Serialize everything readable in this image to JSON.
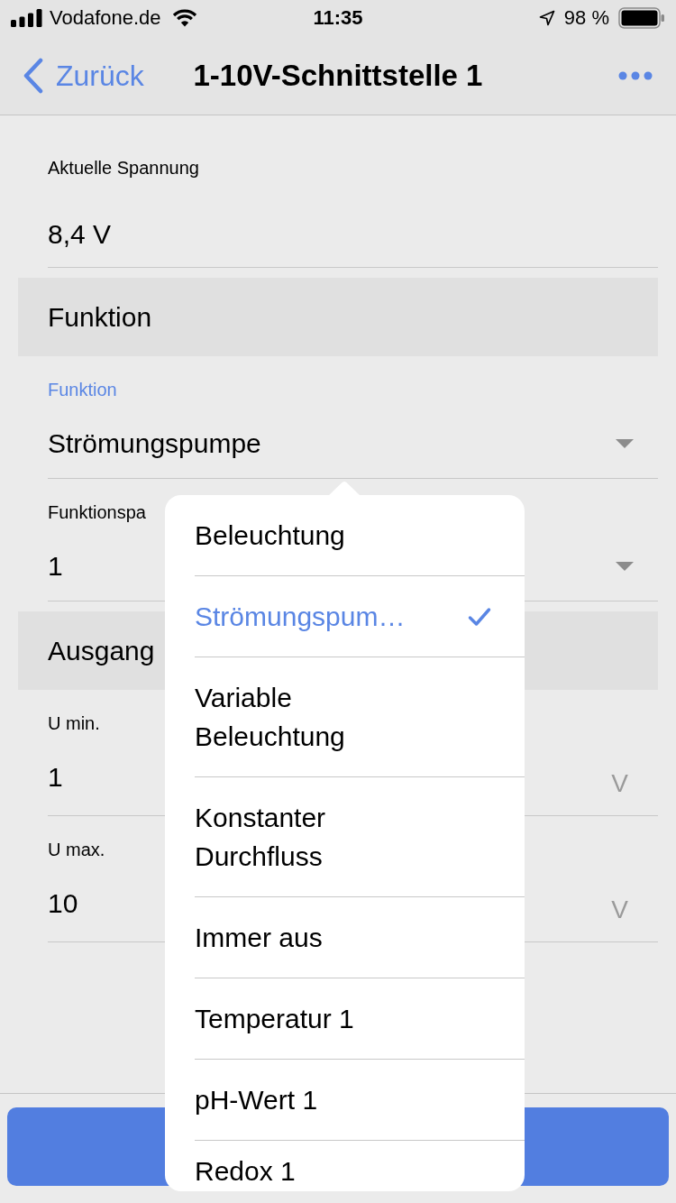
{
  "status_bar": {
    "carrier": "Vodafone.de",
    "time": "11:35",
    "battery": "98 %"
  },
  "nav_bar": {
    "back_label": "Zurück",
    "title": "1-10V-Schnittstelle 1"
  },
  "current_voltage": {
    "label": "Aktuelle Spannung",
    "value": "8,4 V"
  },
  "sections": [
    {
      "title": "Funktion",
      "fields": [
        {
          "kind": "select",
          "label": "Funktion",
          "value": "Strömungspumpe",
          "focused": true
        },
        {
          "kind": "select",
          "label": "Funktionspa",
          "value": "1",
          "focused": false
        }
      ]
    },
    {
      "title": "Ausgang",
      "fields": [
        {
          "kind": "number",
          "label": "U min.",
          "value": "1",
          "unit": "V",
          "focused": false
        },
        {
          "kind": "number",
          "label": "U max.",
          "value": "10",
          "unit": "V",
          "focused": false
        }
      ]
    }
  ],
  "dropdown": {
    "options": [
      {
        "label": "Beleuchtung",
        "selected": false
      },
      {
        "label": "Strömungspum…",
        "selected": true
      },
      {
        "label": "Variable Beleuchtung",
        "selected": false
      },
      {
        "label": "Konstanter Durchfluss",
        "selected": false
      },
      {
        "label": "Immer aus",
        "selected": false
      },
      {
        "label": "Temperatur 1",
        "selected": false
      },
      {
        "label": "pH-Wert 1",
        "selected": false
      },
      {
        "label": "Redox 1",
        "selected": false
      }
    ]
  }
}
